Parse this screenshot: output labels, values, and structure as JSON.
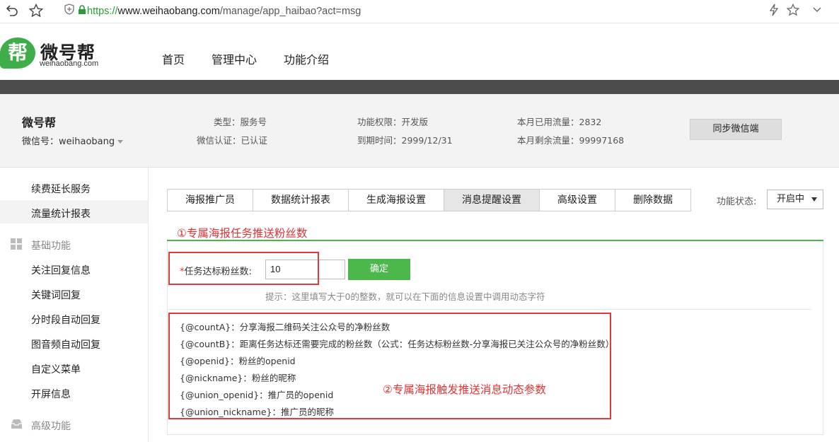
{
  "browser": {
    "url_protocol": "https://",
    "url_host": "www.weihaobang.com",
    "url_path": "/manage/app_haibao?act=msg",
    "icons": [
      "back-icon",
      "star-icon",
      "shield-icon",
      "lock-icon",
      "lightning-icon",
      "star-outline-icon",
      "chevron-down-icon"
    ]
  },
  "site": {
    "logo_char": "帮",
    "logo_name": "微号帮",
    "logo_sub": "weihaobang.com",
    "nav": [
      "首页",
      "管理中心",
      "功能介绍"
    ]
  },
  "account": {
    "name": "微号帮",
    "id_label": "微信号：",
    "id_value": "weihaobang",
    "type_label": "类型：",
    "type_value": "服务号",
    "verify_label": "微信认证：",
    "verify_value": "已认证",
    "perm_label": "功能权限：",
    "perm_value": "开发版",
    "expire_label": "到期时间：",
    "expire_value": "2999/12/31",
    "used_label": "本月已用流量：",
    "used_value": "2832",
    "remain_label": "本月剩余流量：",
    "remain_value": "99997168",
    "sync_button": "同步微信端"
  },
  "sidebar": {
    "items_top": [
      "续费延长服务",
      "流量统计报表"
    ],
    "active": "流量统计报表",
    "group_basic": "基础功能",
    "items_basic": [
      "关注回复信息",
      "关键词回复",
      "分时段自动回复",
      "图音频自动回复",
      "自定义菜单",
      "开屏信息"
    ],
    "group_advanced": "高级功能"
  },
  "tabs": [
    "海报推广员",
    "数据统计报表",
    "生成海报设置",
    "消息提醒设置",
    "高级设置",
    "删除数据"
  ],
  "active_tab": "消息提醒设置",
  "status": {
    "label": "功能状态:",
    "value": "开启中"
  },
  "section1": {
    "title": "①专属海报任务推送粉丝数",
    "star": "*",
    "field_label": "任务达标粉丝数:",
    "field_value": "10",
    "confirm": "确定",
    "hint": "提示：这里填写大于0的整数，就可以在下面的信息设置中调用动态字符"
  },
  "params": [
    "{@countA}：分享海报二维码关注公众号的净粉丝数",
    "{@countB}：距离任务达标还需要完成的粉丝数（公式：任务达标粉丝数-分享海报已关注公众号的净粉丝数）",
    "{@openid}：粉丝的openid",
    "{@nickname}：粉丝的昵称",
    "{@union_openid}：推广员的openid",
    "{@union_nickname}：推广员的昵称"
  ],
  "section2": {
    "title": "②专属海报触发推送消息动态参数"
  },
  "colors": {
    "brand_green": "#3fae49",
    "annotation_red": "#e0393a",
    "button_green": "#4cb84c"
  }
}
